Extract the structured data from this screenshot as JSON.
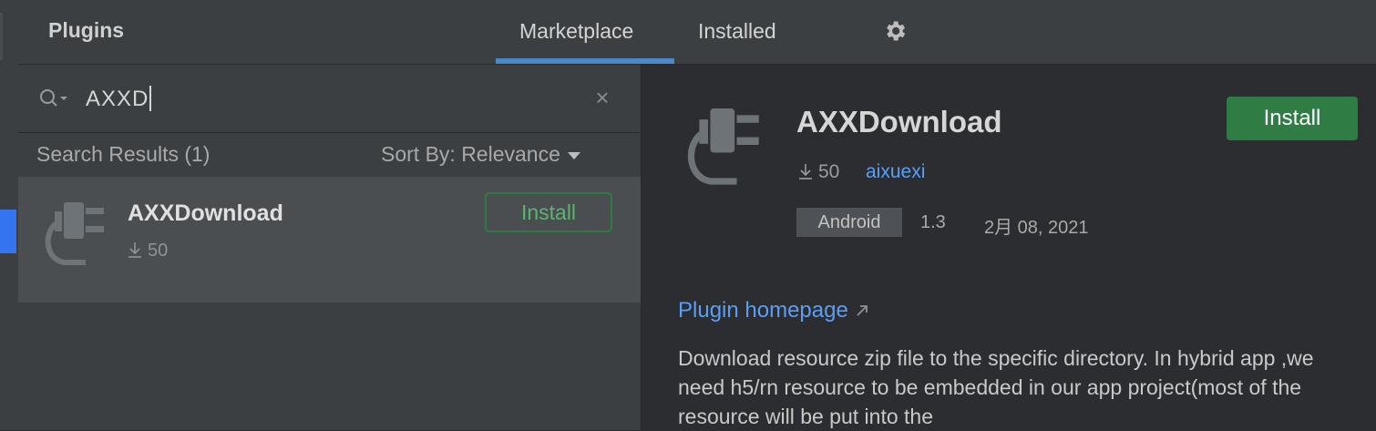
{
  "header": {
    "title": "Plugins",
    "tabs": [
      {
        "label": "Marketplace",
        "active": true
      },
      {
        "label": "Installed",
        "active": false
      }
    ],
    "settings_icon": "gear-icon"
  },
  "search": {
    "value": "AXXD",
    "icon": "search-icon",
    "clear_icon": "×"
  },
  "results": {
    "count_label": "Search Results (1)",
    "sort_label": "Sort By: Relevance",
    "items": [
      {
        "name": "AXXDownload",
        "downloads": "50",
        "install_label": "Install",
        "icon": "plugin-plug-icon"
      }
    ]
  },
  "detail": {
    "name": "AXXDownload",
    "install_label": "Install",
    "downloads": "50",
    "vendor": "aixuexi",
    "tag": "Android",
    "version": "1.3",
    "date": "2月 08, 2021",
    "homepage_label": "Plugin homepage",
    "description": "Download resource zip file to the specific directory. In hybrid app ,we need h5/rn resource to be embedded in our app project(most of the resource will be put into the"
  },
  "colors": {
    "accent": "#4a88c7",
    "install_green": "#2f7d45",
    "link_blue": "#5a9ff5"
  }
}
